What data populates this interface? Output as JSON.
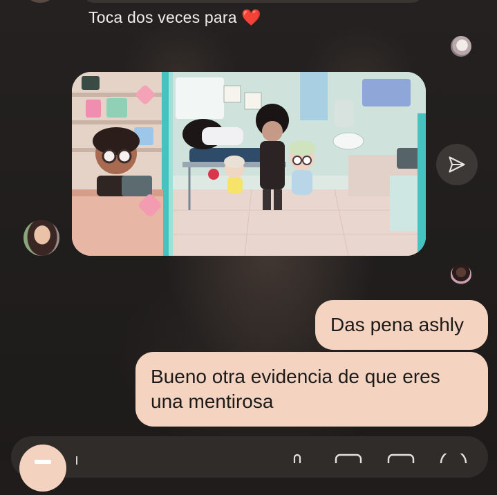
{
  "reaction_hint": {
    "text": "Toca dos veces para",
    "emoji": "❤️"
  },
  "media_message": {
    "image_icon_name": "game-hospital-scene-image",
    "share_icon_name": "paper-plane-icon"
  },
  "messages": [
    {
      "text": "Das pena ashly"
    },
    {
      "text": "Bueno otra evidencia de que eres una mentirosa"
    }
  ],
  "composer": {
    "camera_icon_name": "camera-icon",
    "icons": [
      "microphone-icon",
      "gallery-icon",
      "sticker-icon",
      "emoji-icon"
    ]
  },
  "colors": {
    "background": "#1f1c1b",
    "outgoing_bubble": "#f4d3c0",
    "outgoing_text": "#1c1a19",
    "hint_text": "#f1ece9",
    "heart": "#e8202d",
    "share_button": "#3b3836"
  }
}
